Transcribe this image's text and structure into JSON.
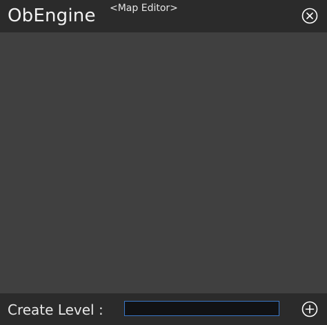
{
  "header": {
    "app_name": "ObEngine",
    "mode_title": "<Map Editor>"
  },
  "footer": {
    "create_level_label": "Create Level :",
    "level_name_value": "",
    "level_name_placeholder": ""
  },
  "icons": {
    "close": "close-circle-icon",
    "add": "plus-circle-icon"
  },
  "colors": {
    "title_bar": "#2b2b2b",
    "content": "#404040",
    "input_border": "#3a78c8",
    "input_bg": "#111214"
  }
}
